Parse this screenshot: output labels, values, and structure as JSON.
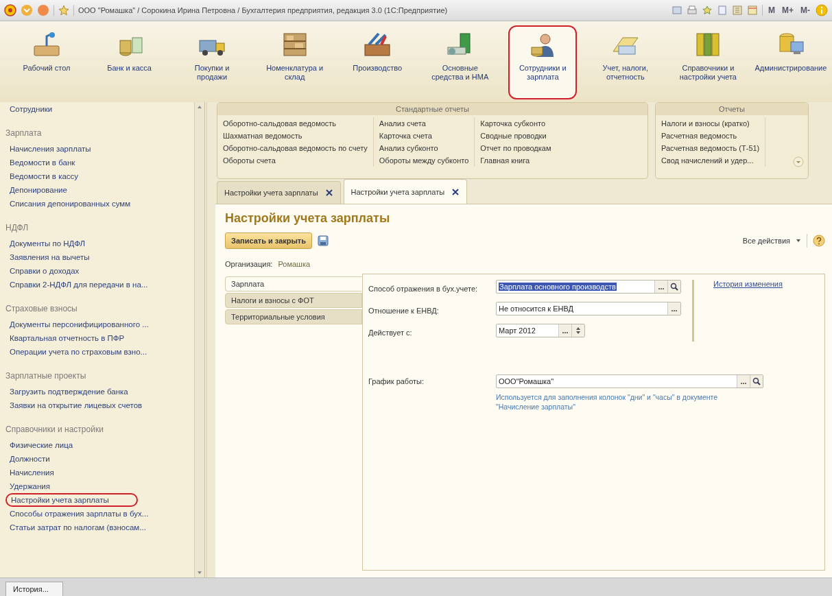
{
  "window": {
    "title": "ООО \"Ромашка\" / Сорокина Ирина Петровна / Бухгалтерия предприятия, редакция 3.0  (1С:Предприятие)",
    "memory_buttons": [
      "M",
      "M+",
      "M-"
    ]
  },
  "sections": [
    {
      "label": "Рабочий стол",
      "selected": false
    },
    {
      "label": "Банк и касса",
      "selected": false
    },
    {
      "label": "Покупки и продажи",
      "selected": false
    },
    {
      "label": "Номенклатура и склад",
      "selected": false
    },
    {
      "label": "Производство",
      "selected": false
    },
    {
      "label": "Основные средства и НМА",
      "selected": false
    },
    {
      "label": "Сотрудники и зарплата",
      "selected": true
    },
    {
      "label": "Учет, налоги, отчетность",
      "selected": false
    },
    {
      "label": "Справочники и настройки учета",
      "selected": false
    },
    {
      "label": "Администрирование",
      "selected": false
    }
  ],
  "sidebar": {
    "groups": [
      {
        "items": [
          {
            "label": "Сотрудники",
            "selected": false
          }
        ]
      },
      {
        "title": "Зарплата",
        "items": [
          {
            "label": "Начисления зарплаты",
            "selected": false
          },
          {
            "label": "Ведомости в банк",
            "selected": false
          },
          {
            "label": "Ведомости в кассу",
            "selected": false
          },
          {
            "label": "Депонирование",
            "selected": false
          },
          {
            "label": "Списания депонированных сумм",
            "selected": false
          }
        ]
      },
      {
        "title": "НДФЛ",
        "items": [
          {
            "label": "Документы по НДФЛ",
            "selected": false
          },
          {
            "label": "Заявления на вычеты",
            "selected": false
          },
          {
            "label": "Справки о доходах",
            "selected": false
          },
          {
            "label": "Справки 2-НДФЛ для передачи в на...",
            "selected": false
          }
        ]
      },
      {
        "title": "Страховые взносы",
        "items": [
          {
            "label": "Документы персонифицированного ...",
            "selected": false
          },
          {
            "label": "Квартальная отчетность в ПФР",
            "selected": false
          },
          {
            "label": "Операции учета по страховым взно...",
            "selected": false
          }
        ]
      },
      {
        "title": "Зарплатные проекты",
        "items": [
          {
            "label": "Загрузить подтверждение банка",
            "selected": false
          },
          {
            "label": "Заявки на открытие лицевых счетов",
            "selected": false
          }
        ]
      },
      {
        "title": "Справочники и настройки",
        "items": [
          {
            "label": "Физические лица",
            "selected": false
          },
          {
            "label": "Должности",
            "selected": false
          },
          {
            "label": "Начисления",
            "selected": false
          },
          {
            "label": "Удержания",
            "selected": false
          },
          {
            "label": "Настройки учета зарплаты",
            "selected": true
          },
          {
            "label": "Способы отражения зарплаты в бух...",
            "selected": false
          },
          {
            "label": "Статьи затрат по налогам (взносам...",
            "selected": false
          }
        ]
      }
    ]
  },
  "reports": [
    {
      "title": "Стандартные отчеты",
      "columns": [
        [
          "Оборотно-сальдовая ведомость",
          "Шахматная ведомость",
          "Оборотно-сальдовая ведомость по счету",
          "Обороты счета"
        ],
        [
          "Анализ счета",
          "Карточка счета",
          "Анализ субконто",
          "Обороты между субконто"
        ],
        [
          "Карточка субконто",
          "Сводные проводки",
          "Отчет по проводкам",
          "Главная книга"
        ]
      ]
    },
    {
      "title": "Отчеты",
      "columns": [
        [
          "Налоги и взносы (кратко)",
          "Расчетная ведомость",
          "Расчетная ведомость (Т-51)",
          "Свод начислений и удер..."
        ]
      ]
    }
  ],
  "tabs": [
    {
      "label": "Настройки учета зарплаты",
      "selected": false
    },
    {
      "label": "Настройки учета зарплаты",
      "selected": true
    }
  ],
  "form": {
    "title": "Настройки учета зарплаты",
    "save_close": "Записать и закрыть",
    "all_actions": "Все действия",
    "organization_label": "Организация:",
    "organization": "Ромашка",
    "pages": [
      {
        "label": "Зарплата",
        "selected": true
      },
      {
        "label": "Налоги и взносы с ФОТ",
        "selected": false
      },
      {
        "label": "Территориальные условия",
        "selected": false
      }
    ],
    "fields": [
      {
        "label": "Способ отражения в бух.учете:",
        "value": "Зарплата основного производств",
        "text_selected": true,
        "buttons": [
          {
            "kind": "choice",
            "label": "..."
          },
          {
            "kind": "open"
          }
        ]
      },
      {
        "label": "Отношение к ЕНВД:",
        "value": "Не относится к ЕНВД",
        "text_selected": false,
        "buttons": [
          {
            "kind": "choice",
            "label": "..."
          }
        ]
      },
      {
        "label": "Действует с:",
        "value": "Март 2012",
        "text_selected": false,
        "buttons": [
          {
            "kind": "choice",
            "label": "..."
          },
          {
            "kind": "spin"
          }
        ]
      },
      {
        "label": "График работы:",
        "value": "ООО\"Ромашка\"",
        "text_selected": false,
        "buttons": [
          {
            "kind": "choice",
            "label": "..."
          },
          {
            "kind": "open"
          }
        ],
        "hint": "Используется для заполнения колонок \"дни\" и \"часы\" в документе \"Начисление зарплаты\""
      }
    ],
    "history_link": "История изменения"
  },
  "status_bar": {
    "history_button": "История..."
  }
}
